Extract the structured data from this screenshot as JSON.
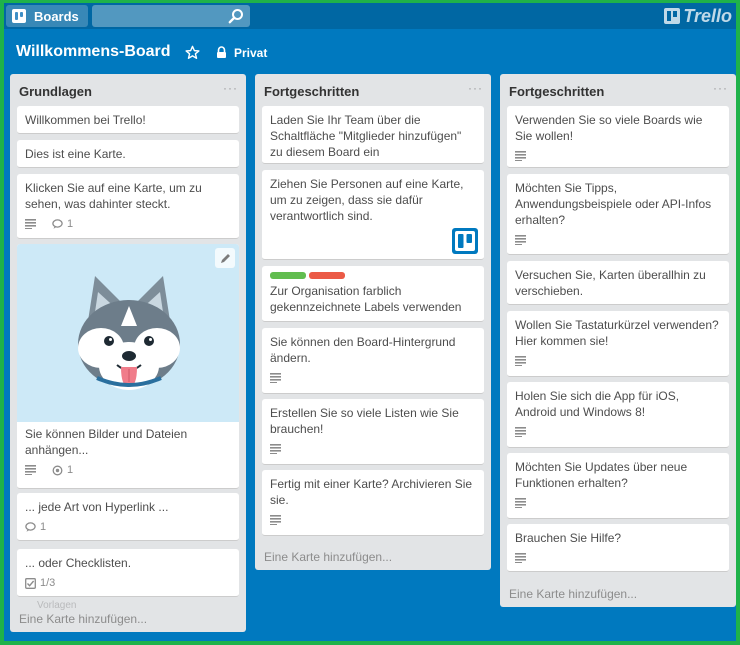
{
  "header": {
    "boards_label": "Boards",
    "search_value": "",
    "logo_text": "Trello"
  },
  "board": {
    "title": "Willkommens-Board",
    "privacy": "Privat"
  },
  "lists": [
    {
      "title": "Grundlagen",
      "menu": "···",
      "add_card": "Eine Karte hinzufügen...",
      "ghost": "Vorlagen",
      "cards": [
        {
          "text": "Willkommen bei Trello!"
        },
        {
          "text": "Dies ist eine Karte."
        },
        {
          "text": "Klicken Sie auf eine Karte, um zu sehen, was dahinter steckt.",
          "comments": "1"
        },
        {
          "text": "Sie können Bilder und Dateien anhängen...",
          "attachments": "1"
        },
        {
          "text": "... jede Art von Hyperlink ...",
          "comments": "1"
        },
        {
          "text": "... oder Checklisten.",
          "checklist": "1/3"
        }
      ]
    },
    {
      "title": "Fortgeschritten",
      "menu": "···",
      "add_card": "Eine Karte hinzufügen...",
      "cards": [
        {
          "text": "Laden Sie Ihr Team über die Schaltfläche \"Mitglieder hinzufügen\" zu diesem Board ein"
        },
        {
          "text": "Ziehen Sie Personen auf eine Karte, um zu zeigen, dass sie dafür verantwortlich sind."
        },
        {
          "text": "Zur Organisation farblich gekennzeichnete Labels verwenden"
        },
        {
          "text": "Sie können den Board-Hintergrund ändern."
        },
        {
          "text": "Erstellen Sie so viele Listen wie Sie brauchen!"
        },
        {
          "text": "Fertig mit einer Karte? Archivieren Sie sie."
        }
      ]
    },
    {
      "title": "Fortgeschritten",
      "menu": "···",
      "add_card": "Eine Karte hinzufügen...",
      "cards": [
        {
          "text": "Verwenden Sie so viele Boards wie Sie wollen!"
        },
        {
          "text": "Möchten Sie Tipps, Anwendungsbeispiele oder API-Infos erhalten?"
        },
        {
          "text": "Versuchen Sie, Karten überallhin zu verschieben."
        },
        {
          "text": "Wollen Sie Tastaturkürzel verwenden? Hier kommen sie!"
        },
        {
          "text": "Holen Sie sich die App für iOS, Android und Windows 8!"
        },
        {
          "text": "Möchten Sie Updates über neue Funktionen erhalten?"
        },
        {
          "text": "Brauchen Sie Hilfe?"
        }
      ]
    }
  ],
  "colors": {
    "frame_border": "#1fb24a",
    "board_bg": "#0079bf",
    "header_bg": "#0067a3",
    "label_green": "#61bd4f",
    "label_red": "#eb5a46"
  }
}
